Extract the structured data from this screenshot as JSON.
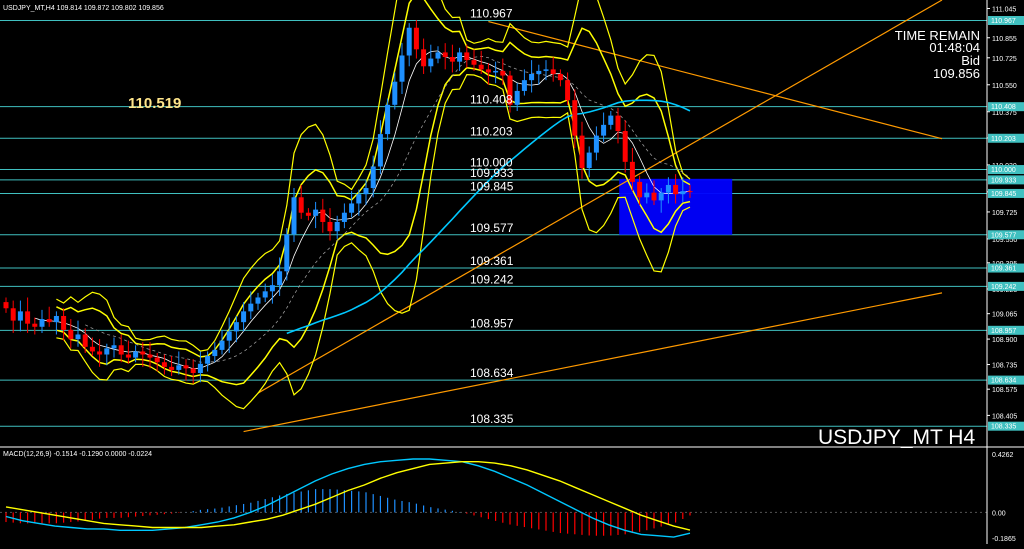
{
  "header": {
    "symbol_info": "USDJPY_MT,H4  109.814 109.872 109.802 109.856",
    "time_remain_label": "TIME REMAIN",
    "time_remain_value": "01:48:04",
    "bid_label": "Bid",
    "bid_value": "109.856",
    "watermark": "USDJPY_MT H4",
    "side_level": "110.519"
  },
  "colors": {
    "background": "#000000",
    "up_candle": "#1e90ff",
    "down_candle": "#ff0000",
    "level_line": "#40c0c0",
    "bollinger": "#ffff00",
    "trendline": "#ff9a00",
    "ma_slow": "#00c8ff",
    "macd_line": "#00c8ff",
    "signal_line": "#ffff00",
    "zone": "#0000ff"
  },
  "chart_data": [
    {
      "type": "candlestick",
      "title": "USDJPY_MT,H4",
      "ylim": [
        108.3,
        111.0
      ],
      "price_axis_ticks": [
        "111.045",
        "110.855",
        "110.725",
        "110.550",
        "110.375",
        "110.205",
        "110.030",
        "109.855",
        "109.725",
        "109.550",
        "109.395",
        "109.225",
        "109.065",
        "108.900",
        "108.735",
        "108.575",
        "108.405"
      ],
      "levels": [
        {
          "value": 110.967,
          "label": "110.967"
        },
        {
          "value": 110.408,
          "label": "110.408"
        },
        {
          "value": 110.203,
          "label": "110.203"
        },
        {
          "value": 110.0,
          "label": "110.000"
        },
        {
          "value": 109.933,
          "label": "109.933"
        },
        {
          "value": 109.845,
          "label": "109.845"
        },
        {
          "value": 109.577,
          "label": "109.577"
        },
        {
          "value": 109.361,
          "label": "109.361"
        },
        {
          "value": 109.242,
          "label": "109.242"
        },
        {
          "value": 108.957,
          "label": "108.957"
        },
        {
          "value": 108.634,
          "label": "108.634"
        },
        {
          "value": 108.335,
          "label": "108.335"
        }
      ],
      "closes": [
        109.1,
        109.02,
        109.08,
        109.0,
        108.98,
        109.03,
        109.01,
        109.05,
        108.96,
        108.9,
        108.93,
        108.85,
        108.82,
        108.8,
        108.84,
        108.86,
        108.8,
        108.78,
        108.82,
        108.8,
        108.78,
        108.75,
        108.72,
        108.7,
        108.73,
        108.71,
        108.68,
        108.74,
        108.79,
        108.83,
        108.89,
        108.95,
        109.01,
        109.08,
        109.13,
        109.17,
        109.21,
        109.25,
        109.34,
        109.58,
        109.82,
        109.72,
        109.7,
        109.74,
        109.66,
        109.6,
        109.66,
        109.72,
        109.78,
        109.84,
        109.88,
        110.02,
        110.23,
        110.42,
        110.57,
        110.74,
        110.92,
        110.78,
        110.67,
        110.72,
        110.76,
        110.73,
        110.7,
        110.76,
        110.71,
        110.68,
        110.65,
        110.63,
        110.64,
        110.61,
        110.42,
        110.51,
        110.58,
        110.62,
        110.64,
        110.65,
        110.62,
        110.58,
        110.45,
        110.22,
        110.01,
        110.11,
        110.22,
        110.29,
        110.35,
        110.25,
        110.05,
        109.92,
        109.82,
        109.85,
        109.8,
        109.85,
        109.9,
        109.84,
        109.86,
        109.856
      ],
      "zone": {
        "from": 109.577,
        "to": 109.94
      },
      "trendlines": [
        {
          "from_bar": 67,
          "from_price": 110.96,
          "to_bar": 130,
          "to_price": 110.2
        },
        {
          "from_bar": 35,
          "from_price": 108.55,
          "to_bar": 130,
          "to_price": 111.1
        },
        {
          "from_bar": 33,
          "from_price": 108.3,
          "to_bar": 130,
          "to_price": 109.2
        }
      ]
    },
    {
      "type": "line",
      "title": "MACD(12,26,9) -0.1514 -0.1290 0.0000 -0.0224",
      "ylim": [
        -0.1865,
        0.4262
      ],
      "axis_ticks": [
        "0.4262",
        "0.00",
        "-0.1865"
      ],
      "series": [
        {
          "name": "MACD",
          "values": [
            -0.03,
            -0.06,
            -0.08,
            -0.1,
            -0.11,
            -0.12,
            -0.12,
            -0.13,
            -0.13,
            -0.13,
            -0.12,
            -0.11,
            -0.09,
            -0.07,
            -0.04,
            0.0,
            0.05,
            0.11,
            0.17,
            0.23,
            0.28,
            0.32,
            0.35,
            0.37,
            0.38,
            0.39,
            0.39,
            0.38,
            0.37,
            0.34,
            0.3,
            0.25,
            0.2,
            0.14,
            0.08,
            0.02,
            -0.04,
            -0.09,
            -0.13,
            -0.16,
            -0.17,
            -0.18,
            -0.1514
          ]
        },
        {
          "name": "Signal",
          "values": [
            0.04,
            0.02,
            0.0,
            -0.02,
            -0.04,
            -0.06,
            -0.08,
            -0.09,
            -0.1,
            -0.11,
            -0.11,
            -0.11,
            -0.11,
            -0.1,
            -0.09,
            -0.07,
            -0.05,
            -0.02,
            0.02,
            0.06,
            0.11,
            0.16,
            0.2,
            0.25,
            0.29,
            0.32,
            0.35,
            0.36,
            0.37,
            0.37,
            0.36,
            0.34,
            0.31,
            0.27,
            0.23,
            0.18,
            0.13,
            0.08,
            0.03,
            -0.02,
            -0.06,
            -0.1,
            -0.129
          ]
        }
      ]
    }
  ]
}
